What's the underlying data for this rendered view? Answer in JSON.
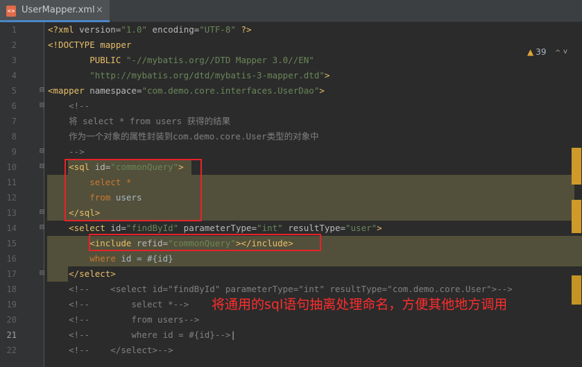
{
  "tab": {
    "filename": "UserMapper.xml",
    "icon": "xml-file-icon",
    "close": "×",
    "icon_text": "<>"
  },
  "inspections": {
    "count": "39",
    "up": "^",
    "down": "v"
  },
  "lines": [
    {
      "num": "1",
      "tokens": [
        {
          "t": "<?xml ",
          "c": "tag"
        },
        {
          "t": "version=",
          "c": "attr"
        },
        {
          "t": "\"1.0\"",
          "c": "val"
        },
        {
          "t": " encoding=",
          "c": "attr"
        },
        {
          "t": "\"UTF-8\"",
          "c": "val"
        },
        {
          "t": " ?>",
          "c": "tag"
        }
      ]
    },
    {
      "num": "2",
      "tokens": [
        {
          "t": "<!DOCTYPE mapper",
          "c": "tag"
        }
      ]
    },
    {
      "num": "3",
      "tokens": [
        {
          "t": "        PUBLIC ",
          "c": "tag"
        },
        {
          "t": "\"-//mybatis.org//DTD Mapper 3.0//EN\"",
          "c": "val"
        }
      ]
    },
    {
      "num": "4",
      "tokens": [
        {
          "t": "        ",
          "c": "plain"
        },
        {
          "t": "\"http://mybatis.org/dtd/mybatis-3-mapper.dtd\"",
          "c": "val"
        },
        {
          "t": ">",
          "c": "tag"
        }
      ]
    },
    {
      "num": "5",
      "tokens": [
        {
          "t": "<mapper ",
          "c": "tag"
        },
        {
          "t": "namespace=",
          "c": "attr"
        },
        {
          "t": "\"com.demo.core.interfaces.UserDao\"",
          "c": "val"
        },
        {
          "t": ">",
          "c": "tag"
        }
      ]
    },
    {
      "num": "6",
      "tokens": [
        {
          "t": "    <!--",
          "c": "cmt"
        }
      ]
    },
    {
      "num": "7",
      "tokens": [
        {
          "t": "    将 select * from users 获得的结果",
          "c": "cmt"
        }
      ]
    },
    {
      "num": "8",
      "tokens": [
        {
          "t": "    作为一个对象的属性封装到com.demo.core.User类型的对象中",
          "c": "cmt"
        }
      ]
    },
    {
      "num": "9",
      "tokens": [
        {
          "t": "    -->",
          "c": "cmt"
        }
      ]
    },
    {
      "num": "10",
      "tokens": [
        {
          "t": "    <sql ",
          "c": "tag"
        },
        {
          "t": "id=",
          "c": "attr"
        },
        {
          "t": "\"commonQuery\"",
          "c": "val"
        },
        {
          "t": ">",
          "c": "tag"
        }
      ]
    },
    {
      "num": "11",
      "tokens": [
        {
          "t": "        ",
          "c": "plain"
        },
        {
          "t": "select",
          "c": "kw"
        },
        {
          "t": " *",
          "c": "kw"
        }
      ]
    },
    {
      "num": "12",
      "tokens": [
        {
          "t": "        ",
          "c": "plain"
        },
        {
          "t": "from",
          "c": "kw"
        },
        {
          "t": " users",
          "c": "plain"
        }
      ]
    },
    {
      "num": "13",
      "tokens": [
        {
          "t": "    </sql>",
          "c": "tag"
        }
      ]
    },
    {
      "num": "14",
      "tokens": [
        {
          "t": "    <select ",
          "c": "tag"
        },
        {
          "t": "id=",
          "c": "attr"
        },
        {
          "t": "\"findById\"",
          "c": "val"
        },
        {
          "t": " parameterType=",
          "c": "attr"
        },
        {
          "t": "\"int\"",
          "c": "val"
        },
        {
          "t": " resultType=",
          "c": "attr"
        },
        {
          "t": "\"user\"",
          "c": "val"
        },
        {
          "t": ">",
          "c": "tag"
        }
      ]
    },
    {
      "num": "15",
      "tokens": [
        {
          "t": "        <include ",
          "c": "tag"
        },
        {
          "t": "refid=",
          "c": "attr"
        },
        {
          "t": "\"commonQuery\"",
          "c": "val"
        },
        {
          "t": "></include>",
          "c": "tag"
        }
      ]
    },
    {
      "num": "16",
      "tokens": [
        {
          "t": "        ",
          "c": "plain"
        },
        {
          "t": "where",
          "c": "kw"
        },
        {
          "t": " id = #{id}",
          "c": "plain"
        }
      ]
    },
    {
      "num": "17",
      "tokens": [
        {
          "t": "    </select>",
          "c": "tag"
        }
      ]
    },
    {
      "num": "18",
      "tokens": [
        {
          "t": "    <!--    <select id=\"findById\" parameterType=\"int\" resultType=\"com.demo.core.User\">-->",
          "c": "cmt"
        }
      ]
    },
    {
      "num": "19",
      "tokens": [
        {
          "t": "    <!--        select *-->",
          "c": "cmt"
        }
      ]
    },
    {
      "num": "20",
      "tokens": [
        {
          "t": "    <!--        from users-->",
          "c": "cmt"
        }
      ]
    },
    {
      "num": "21",
      "tokens": [
        {
          "t": "    <!--        where id = #{id}-->",
          "c": "cmt"
        },
        {
          "t": "|",
          "c": "plain"
        }
      ]
    },
    {
      "num": "22",
      "tokens": [
        {
          "t": "    <!--    </select>-->",
          "c": "cmt"
        }
      ]
    }
  ],
  "annotation": "将通用的sql语句抽离处理命名，方便其他地方调用",
  "colors": {
    "highlight": "#52503a",
    "box": "#e8222a",
    "annotation": "#ff2d2d",
    "tag": "#e8bf6a",
    "value": "#6a8759",
    "comment": "#808080",
    "keyword": "#cc7832"
  }
}
